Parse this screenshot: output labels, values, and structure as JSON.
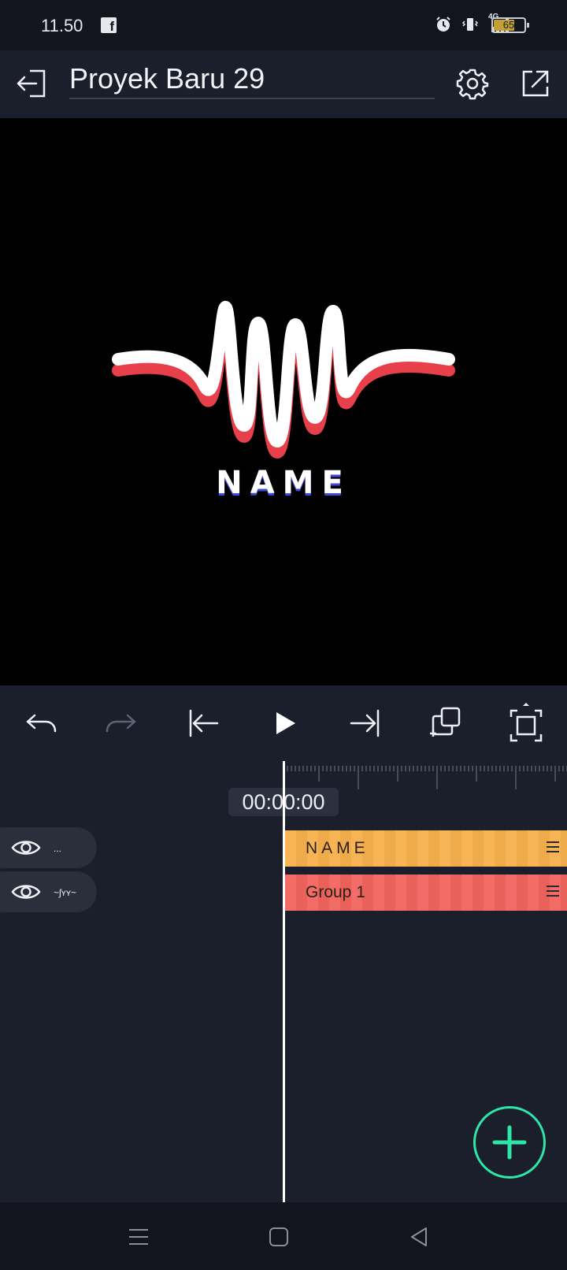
{
  "status_bar": {
    "time": "11.50",
    "network": "4G",
    "battery": "65",
    "battery_level": 0.65,
    "icons": [
      "facebook-icon",
      "alarm-icon",
      "vibrate-icon",
      "signal-icon",
      "battery-icon"
    ]
  },
  "header": {
    "project_title": "Proyek Baru 29",
    "icons": [
      "exit-icon",
      "settings-gear-icon",
      "export-share-icon"
    ]
  },
  "preview": {
    "logo_text": "NAME",
    "colors": {
      "background": "#000000",
      "wave_front": "#ffffff",
      "wave_shadow": "#e8404a",
      "text_shadow": "#3f4ad8"
    }
  },
  "toolbar": {
    "icons": [
      "undo-icon",
      "redo-icon",
      "skip-to-start-icon",
      "play-icon",
      "skip-to-end-icon",
      "duplicate-layer-icon",
      "fullscreen-icon"
    ]
  },
  "timeline": {
    "timecode": "00:00:00",
    "layers": [
      {
        "thumb": "...",
        "clip_label": "NAME",
        "clip_color": "#f7b04c"
      },
      {
        "thumb": "~ʃʏʏ~",
        "clip_label": "Group 1",
        "clip_color": "#f2645f"
      }
    ]
  },
  "fab": {
    "icon": "plus-icon",
    "color": "#2ee6a8"
  },
  "navbar": {
    "icons": [
      "recents-menu-icon",
      "home-square-icon",
      "back-triangle-icon"
    ]
  }
}
